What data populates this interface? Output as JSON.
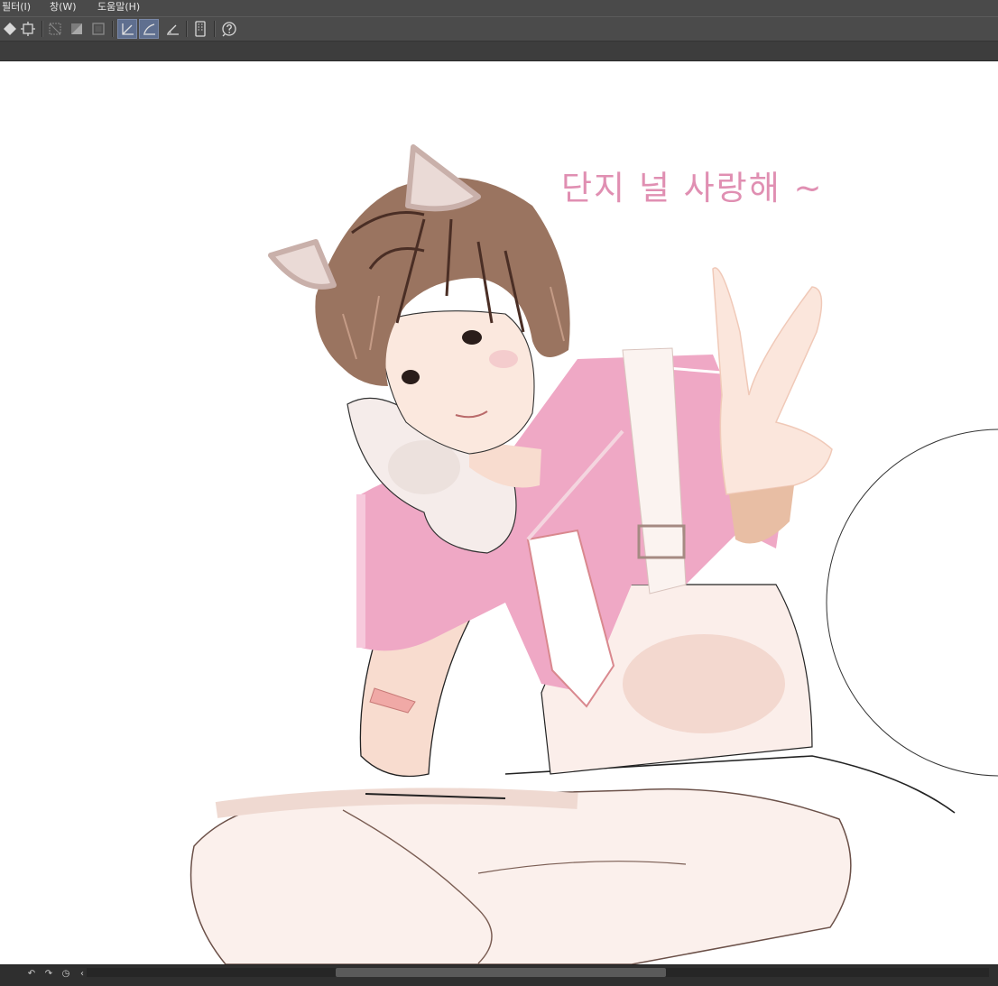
{
  "menu": {
    "items": [
      {
        "label": "필터(I)"
      },
      {
        "label": "창(W)"
      },
      {
        "label": "도움말(H)"
      }
    ]
  },
  "toolbar": {
    "icons": [
      "fill-icon",
      "transform-icon",
      "selection-toggle-icon",
      "mask-icon",
      "frame-icon",
      "snap-ruler-icon",
      "snap-curve-icon",
      "snap-grid-icon",
      "device-icon",
      "help-icon"
    ],
    "active": [
      "snap-ruler-icon",
      "snap-curve-icon"
    ]
  },
  "canvas": {
    "caption": "단지 널 사랑해 ~",
    "caption_color": "#e08fb2"
  },
  "statusbar": {
    "icons": [
      "undo-icon",
      "redo-icon",
      "history-icon",
      "scroll-left-icon"
    ]
  },
  "colors": {
    "ui_dark": "#4a4a4a",
    "shirt_pink": "#efa8c5",
    "hair_brown": "#9a7460",
    "skin": "#f8dccf"
  }
}
